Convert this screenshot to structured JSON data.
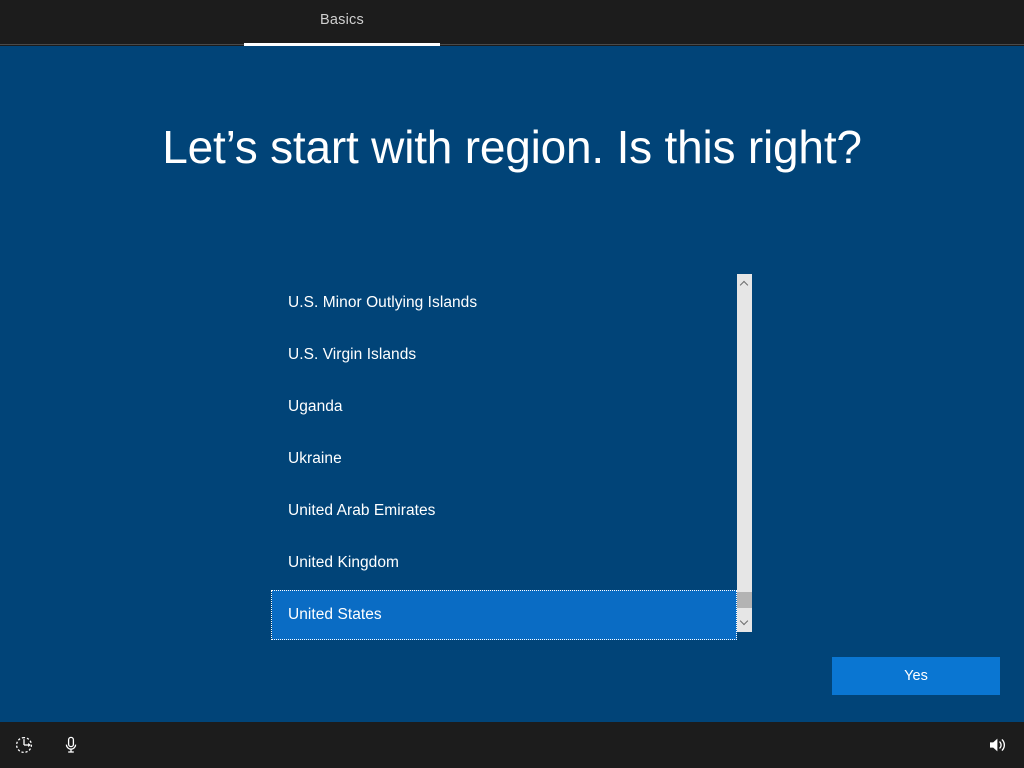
{
  "header": {
    "tab_label": "Basics"
  },
  "main": {
    "title": "Let’s start with region. Is this right?",
    "region_list": {
      "items": [
        {
          "label": "U.S. Minor Outlying Islands",
          "selected": false
        },
        {
          "label": "U.S. Virgin Islands",
          "selected": false
        },
        {
          "label": "Uganda",
          "selected": false
        },
        {
          "label": "Ukraine",
          "selected": false
        },
        {
          "label": "United Arab Emirates",
          "selected": false
        },
        {
          "label": "United Kingdom",
          "selected": false
        },
        {
          "label": "United States",
          "selected": true
        }
      ],
      "selected_value": "United States"
    },
    "confirm_button_label": "Yes"
  },
  "taskbar": {
    "icons": [
      {
        "name": "ease-of-access-icon",
        "label": "Ease of access"
      },
      {
        "name": "microphone-icon",
        "label": "Microphone"
      },
      {
        "name": "volume-icon",
        "label": "Volume"
      }
    ]
  },
  "colors": {
    "background_blue": "#014478",
    "accent_blue": "#0a76d2",
    "selection_blue": "#0a6cc4",
    "chrome_dark": "#1c1c1c",
    "scrollbar_track": "#e6e6e6",
    "scrollbar_thumb": "#b3b3b3"
  }
}
